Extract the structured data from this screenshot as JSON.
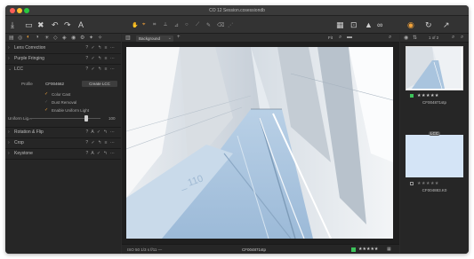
{
  "window": {
    "title": "CO 12 Session.cosessiondb"
  },
  "toolbar": {
    "left_icons": [
      "import-icon",
      "camera-icon",
      "delete-icon",
      "undo-icon",
      "redo-icon",
      "text-icon"
    ],
    "left_glyphs": [
      "⤓",
      "▭",
      "✖",
      "↶",
      "↷",
      "A"
    ],
    "tools": [
      "pan-icon",
      "cursor-icon",
      "crop-icon",
      "straighten-icon",
      "keystone-icon",
      "spot-icon",
      "mask-icon",
      "brush-icon",
      "eraser-icon",
      "color-picker-icon"
    ],
    "tool_glyphs": [
      "✋",
      "⌖",
      "⌗",
      "⟂",
      "⊿",
      "○",
      "⟋",
      "✎",
      "⌫",
      "⋰"
    ],
    "right_icons": [
      "grid-icon",
      "preview-icon",
      "warning-icon",
      "proof-icon",
      "process-icon",
      "copy-icon",
      "paste-icon"
    ],
    "right_glyphs": [
      "▦",
      "⊡",
      "▲",
      "∞",
      "◉",
      "↻",
      "↗"
    ]
  },
  "tool_tabs": [
    "library-tab",
    "capture-tab",
    "lens-tab",
    "color-tab",
    "exposure-tab",
    "detail-tab",
    "local-tab",
    "output-tab",
    "metadata-tab",
    "batch-tab",
    "styles-tab"
  ],
  "tool_tab_glyphs": [
    "▤",
    "◎",
    "◐",
    "◑",
    "☀",
    "◇",
    "◈",
    "◉",
    "⚙",
    "✦",
    "✧"
  ],
  "left_panel": {
    "sections": [
      {
        "label": "Lens Correction",
        "controls": "? ✓ ↰ ≡ ⋯"
      },
      {
        "label": "Purple Fringing",
        "controls": "? ✓ ↰ ≡ ⋯"
      },
      {
        "label": "LCC",
        "controls": "? ✓ ↰ ≡ ⋯"
      }
    ],
    "lcc": {
      "profile_label": "Profile",
      "profile_value": "CF004662",
      "create_button": "Create LCC",
      "checks": [
        "Color Cast",
        "Dust Removal",
        "Enable Uniform Light"
      ],
      "uniform_label": "Uniform Lig...",
      "uniform_value": "100",
      "uniform_level": 0.78
    },
    "lower_sections": [
      {
        "label": "Rotation & Flip",
        "controls": "? A ✓ ↰ ⋯"
      },
      {
        "label": "Crop",
        "controls": "? ✓ ↰ ≡ ⋯"
      },
      {
        "label": "Keystone",
        "controls": "? A ✓ ↰ ⋯"
      }
    ]
  },
  "viewer": {
    "layer_dropdown": "Background",
    "fit_label": "Fit",
    "page_label": "1 of 2",
    "status_left": "ISO 50   1/3 s   f/11   —",
    "status_filename": "CF004871stp",
    "status_stars": "★★★★★"
  },
  "browser": {
    "thumbs": [
      {
        "filename": "CF004871stp",
        "stars": "★★★★★",
        "selected": true
      },
      {
        "filename": "CF004883.K0",
        "stars": "★★★★★",
        "selected": false,
        "badge": "LCC"
      }
    ]
  },
  "colors": {
    "accent": "#f3a33a",
    "green": "#3cc35a",
    "red": "#ff5f57",
    "yellow": "#febc2e",
    "win_green": "#28c840"
  }
}
